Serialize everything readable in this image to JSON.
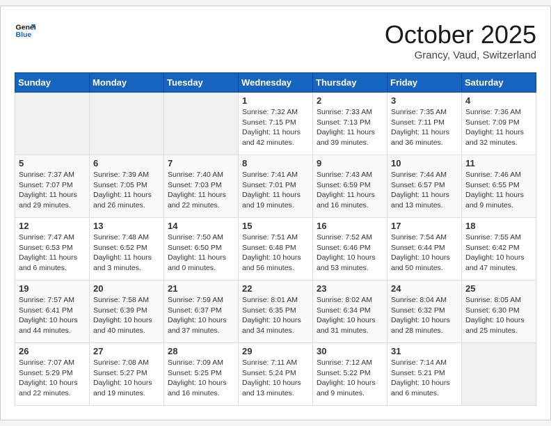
{
  "header": {
    "logo_general": "General",
    "logo_blue": "Blue",
    "month_title": "October 2025",
    "location": "Grancy, Vaud, Switzerland"
  },
  "weekdays": [
    "Sunday",
    "Monday",
    "Tuesday",
    "Wednesday",
    "Thursday",
    "Friday",
    "Saturday"
  ],
  "weeks": [
    [
      {
        "day": "",
        "info": ""
      },
      {
        "day": "",
        "info": ""
      },
      {
        "day": "",
        "info": ""
      },
      {
        "day": "1",
        "info": "Sunrise: 7:32 AM\nSunset: 7:15 PM\nDaylight: 11 hours\nand 42 minutes."
      },
      {
        "day": "2",
        "info": "Sunrise: 7:33 AM\nSunset: 7:13 PM\nDaylight: 11 hours\nand 39 minutes."
      },
      {
        "day": "3",
        "info": "Sunrise: 7:35 AM\nSunset: 7:11 PM\nDaylight: 11 hours\nand 36 minutes."
      },
      {
        "day": "4",
        "info": "Sunrise: 7:36 AM\nSunset: 7:09 PM\nDaylight: 11 hours\nand 32 minutes."
      }
    ],
    [
      {
        "day": "5",
        "info": "Sunrise: 7:37 AM\nSunset: 7:07 PM\nDaylight: 11 hours\nand 29 minutes."
      },
      {
        "day": "6",
        "info": "Sunrise: 7:39 AM\nSunset: 7:05 PM\nDaylight: 11 hours\nand 26 minutes."
      },
      {
        "day": "7",
        "info": "Sunrise: 7:40 AM\nSunset: 7:03 PM\nDaylight: 11 hours\nand 22 minutes."
      },
      {
        "day": "8",
        "info": "Sunrise: 7:41 AM\nSunset: 7:01 PM\nDaylight: 11 hours\nand 19 minutes."
      },
      {
        "day": "9",
        "info": "Sunrise: 7:43 AM\nSunset: 6:59 PM\nDaylight: 11 hours\nand 16 minutes."
      },
      {
        "day": "10",
        "info": "Sunrise: 7:44 AM\nSunset: 6:57 PM\nDaylight: 11 hours\nand 13 minutes."
      },
      {
        "day": "11",
        "info": "Sunrise: 7:46 AM\nSunset: 6:55 PM\nDaylight: 11 hours\nand 9 minutes."
      }
    ],
    [
      {
        "day": "12",
        "info": "Sunrise: 7:47 AM\nSunset: 6:53 PM\nDaylight: 11 hours\nand 6 minutes."
      },
      {
        "day": "13",
        "info": "Sunrise: 7:48 AM\nSunset: 6:52 PM\nDaylight: 11 hours\nand 3 minutes."
      },
      {
        "day": "14",
        "info": "Sunrise: 7:50 AM\nSunset: 6:50 PM\nDaylight: 11 hours\nand 0 minutes."
      },
      {
        "day": "15",
        "info": "Sunrise: 7:51 AM\nSunset: 6:48 PM\nDaylight: 10 hours\nand 56 minutes."
      },
      {
        "day": "16",
        "info": "Sunrise: 7:52 AM\nSunset: 6:46 PM\nDaylight: 10 hours\nand 53 minutes."
      },
      {
        "day": "17",
        "info": "Sunrise: 7:54 AM\nSunset: 6:44 PM\nDaylight: 10 hours\nand 50 minutes."
      },
      {
        "day": "18",
        "info": "Sunrise: 7:55 AM\nSunset: 6:42 PM\nDaylight: 10 hours\nand 47 minutes."
      }
    ],
    [
      {
        "day": "19",
        "info": "Sunrise: 7:57 AM\nSunset: 6:41 PM\nDaylight: 10 hours\nand 44 minutes."
      },
      {
        "day": "20",
        "info": "Sunrise: 7:58 AM\nSunset: 6:39 PM\nDaylight: 10 hours\nand 40 minutes."
      },
      {
        "day": "21",
        "info": "Sunrise: 7:59 AM\nSunset: 6:37 PM\nDaylight: 10 hours\nand 37 minutes."
      },
      {
        "day": "22",
        "info": "Sunrise: 8:01 AM\nSunset: 6:35 PM\nDaylight: 10 hours\nand 34 minutes."
      },
      {
        "day": "23",
        "info": "Sunrise: 8:02 AM\nSunset: 6:34 PM\nDaylight: 10 hours\nand 31 minutes."
      },
      {
        "day": "24",
        "info": "Sunrise: 8:04 AM\nSunset: 6:32 PM\nDaylight: 10 hours\nand 28 minutes."
      },
      {
        "day": "25",
        "info": "Sunrise: 8:05 AM\nSunset: 6:30 PM\nDaylight: 10 hours\nand 25 minutes."
      }
    ],
    [
      {
        "day": "26",
        "info": "Sunrise: 7:07 AM\nSunset: 5:29 PM\nDaylight: 10 hours\nand 22 minutes."
      },
      {
        "day": "27",
        "info": "Sunrise: 7:08 AM\nSunset: 5:27 PM\nDaylight: 10 hours\nand 19 minutes."
      },
      {
        "day": "28",
        "info": "Sunrise: 7:09 AM\nSunset: 5:25 PM\nDaylight: 10 hours\nand 16 minutes."
      },
      {
        "day": "29",
        "info": "Sunrise: 7:11 AM\nSunset: 5:24 PM\nDaylight: 10 hours\nand 13 minutes."
      },
      {
        "day": "30",
        "info": "Sunrise: 7:12 AM\nSunset: 5:22 PM\nDaylight: 10 hours\nand 9 minutes."
      },
      {
        "day": "31",
        "info": "Sunrise: 7:14 AM\nSunset: 5:21 PM\nDaylight: 10 hours\nand 6 minutes."
      },
      {
        "day": "",
        "info": ""
      }
    ]
  ]
}
